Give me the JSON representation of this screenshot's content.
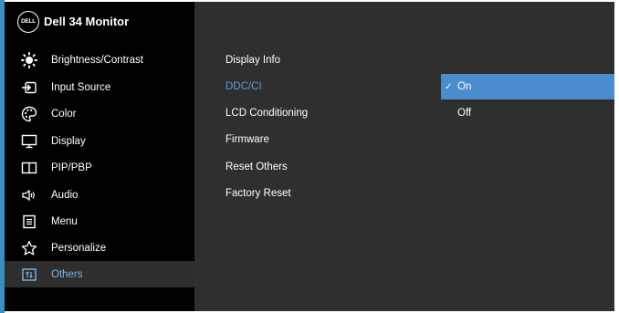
{
  "header": {
    "logo_text": "DELL",
    "title": "Dell 34 Monitor"
  },
  "sidebar": {
    "items": [
      {
        "label": "Brightness/Contrast",
        "icon": "brightness-icon"
      },
      {
        "label": "Input Source",
        "icon": "input-source-icon"
      },
      {
        "label": "Color",
        "icon": "color-palette-icon"
      },
      {
        "label": "Display",
        "icon": "display-icon"
      },
      {
        "label": "PIP/PBP",
        "icon": "pip-pbp-icon"
      },
      {
        "label": "Audio",
        "icon": "speaker-icon"
      },
      {
        "label": "Menu",
        "icon": "menu-icon"
      },
      {
        "label": "Personalize",
        "icon": "star-icon"
      },
      {
        "label": "Others",
        "icon": "others-icon",
        "active": true
      }
    ]
  },
  "submenu": {
    "items": [
      {
        "label": "Display Info"
      },
      {
        "label": "DDC/CI",
        "active": true
      },
      {
        "label": "LCD Conditioning"
      },
      {
        "label": "Firmware"
      },
      {
        "label": "Reset Others"
      },
      {
        "label": "Factory Reset"
      }
    ]
  },
  "options": {
    "items": [
      {
        "label": "On",
        "selected": true,
        "check": "✓"
      },
      {
        "label": "Off"
      }
    ]
  },
  "colors": {
    "accent": "#4a8ccd",
    "highlight_text": "#5a9fd6",
    "panel": "#2f2f2f",
    "sidebar": "#000000"
  }
}
